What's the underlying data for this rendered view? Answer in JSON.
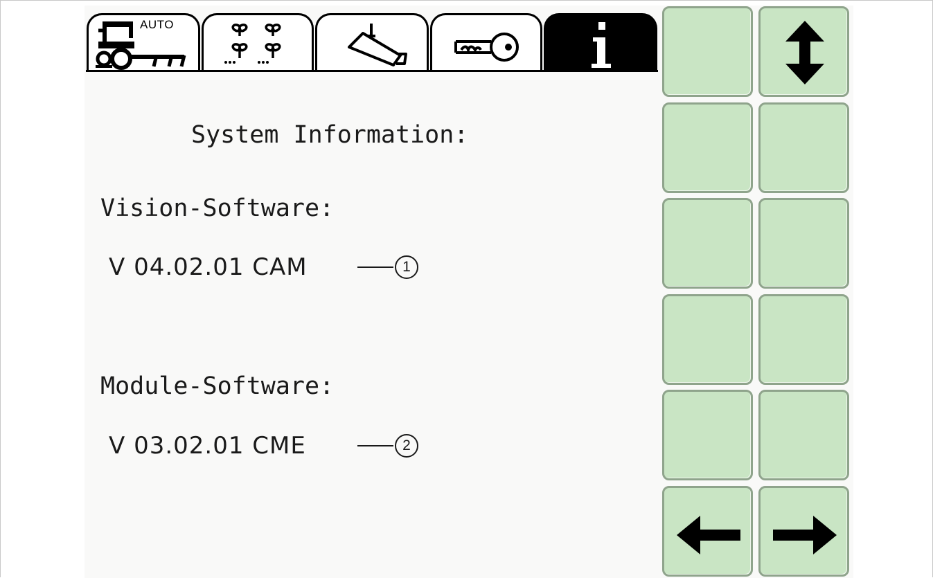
{
  "tabs": [
    {
      "name": "auto-guidance",
      "icon": "tractor-auto-icon",
      "label": "AUTO",
      "active": false
    },
    {
      "name": "rows",
      "icon": "crop-rows-icon",
      "active": false
    },
    {
      "name": "camera",
      "icon": "camera-icon",
      "active": false
    },
    {
      "name": "key",
      "icon": "key-icon",
      "active": false
    },
    {
      "name": "info",
      "icon": "info-icon",
      "active": true
    }
  ],
  "content": {
    "title": "System Information:",
    "vision_label": "Vision-Software:",
    "vision_version": "V 04.02.01 CAM",
    "vision_callout": "1",
    "module_label": "Module-Software:",
    "module_version": "V 03.02.01 CME",
    "module_callout": "2"
  },
  "softkeys": {
    "top_right_icon": "up-down-arrow-icon",
    "bottom_left_icon": "left-arrow-icon",
    "bottom_right_icon": "right-arrow-icon"
  },
  "colors": {
    "softkey_fill": "#c9e5c4",
    "softkey_border": "#8fa48c",
    "screen_bg": "#f9f9f8",
    "active_tab": "#000000"
  }
}
